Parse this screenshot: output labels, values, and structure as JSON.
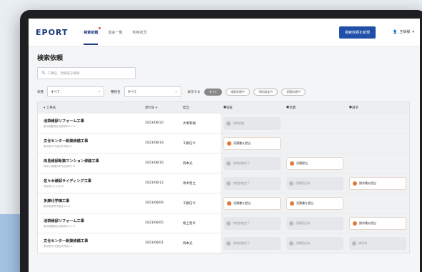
{
  "header": {
    "logo": "EPORT",
    "nav": [
      {
        "label": "検索依頼",
        "active": true
      },
      {
        "label": "退会一覧",
        "active": false
      },
      {
        "label": "利用状況",
        "active": false
      }
    ],
    "new_button": "検索依頼を新規",
    "user": "主婦様",
    "user_chevron": "▾"
  },
  "page": {
    "title": "検索依頼",
    "search_placeholder": "工事名、現場名を検索",
    "filters": {
      "status_label": "状態",
      "status_value": "すべて",
      "type_label": "種別名",
      "type_value": "すべて",
      "sort_label": "表示する",
      "chips": [
        "すべて",
        "検索依頼中",
        "現地調査中",
        "見積依頼中"
      ]
    }
  },
  "table": {
    "headers": [
      "工事名",
      "受付日",
      "担当",
      "調査",
      "見積",
      "請求"
    ],
    "rows": [
      {
        "name": "池袋様邸リフォーム工事",
        "sub": "東京都豊島区池袋本町1-2-3",
        "date": "2023/08/20",
        "staff": "大塚和樹",
        "survey": {
          "label": "現地調査",
          "state": "pend"
        },
        "quote": null,
        "bill": null
      },
      {
        "name": "文化センター新築修繕工事",
        "sub": "東京都千代田区外神田1-1",
        "date": "2023/08/18",
        "staff": "工藤信介",
        "survey": {
          "label": "見積書を提出",
          "state": "done"
        },
        "quote": null,
        "bill": null
      },
      {
        "name": "田島様邸新築マンション修繕工事",
        "sub": "神奈川県横浜市中区本町2-5",
        "date": "2023/08/16",
        "staff": "岡本光",
        "survey": {
          "label": "現地調査完了",
          "state": "pend"
        },
        "quote": {
          "label": "見積提出",
          "state": "done"
        },
        "bill": null
      },
      {
        "name": "佐々木様邸サイディング工事",
        "sub": "埼玉県さいたま市",
        "date": "2023/08/12",
        "staff": "青木智之",
        "survey": {
          "label": "現地調査完了",
          "state": "pend"
        },
        "quote": {
          "label": "見積提出済",
          "state": "pend"
        },
        "bill": {
          "label": "請求書を提出",
          "state": "done"
        }
      },
      {
        "name": "多摩化学棟工事",
        "sub": "東京都多摩市落合1-2-3",
        "date": "2023/08/09",
        "staff": "工藤信介",
        "survey": {
          "label": "見積書を提出",
          "state": "done"
        },
        "quote": {
          "label": "見積書を提出",
          "state": "done"
        },
        "bill": null
      },
      {
        "name": "池袋様邸リフォーム工事",
        "sub": "東京都豊島区池袋本町1-2-3",
        "date": "2023/08/05",
        "staff": "根上智幸",
        "survey": {
          "label": "現地調査完了",
          "state": "pend"
        },
        "quote": {
          "label": "見積提出済",
          "state": "pend"
        },
        "bill": {
          "label": "請求書を提出",
          "state": "done"
        }
      },
      {
        "name": "文化センター新築修繕工事",
        "sub": "東京都千代田区外神田1-1",
        "date": "2023/08/01",
        "staff": "岡本光",
        "survey": {
          "label": "現地調査完了",
          "state": "pend"
        },
        "quote": {
          "label": "見積提出済",
          "state": "pend"
        },
        "bill": {
          "label": "請求済",
          "state": "pend"
        }
      }
    ]
  },
  "colors": {
    "brand": "#1b3a7a",
    "accent": "#1f4fa8",
    "badge": "#e07a3a"
  }
}
